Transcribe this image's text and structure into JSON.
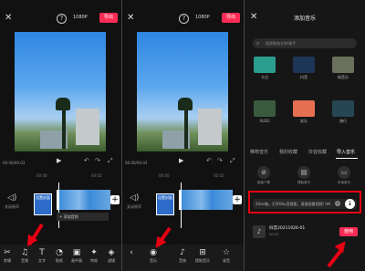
{
  "panel1": {
    "resolution": "1080P",
    "export_label": "导出",
    "timecode": "00:00/00:03",
    "ruler": [
      "00:00",
      "00:02"
    ],
    "mute_label": "关闭原声",
    "cover_label": "设置封面",
    "add_audio_label": "+ 添加音频",
    "tools": [
      {
        "icon": "scissors-icon",
        "glyph": "✂",
        "label": "剪辑"
      },
      {
        "icon": "music-icon",
        "glyph": "♫",
        "label": "音频"
      },
      {
        "icon": "text-icon",
        "glyph": "T",
        "label": "文字"
      },
      {
        "icon": "sticker-icon",
        "glyph": "◔",
        "label": "贴纸"
      },
      {
        "icon": "pip-icon",
        "glyph": "▣",
        "label": "画中画"
      },
      {
        "icon": "effects-icon",
        "glyph": "✦",
        "label": "特效"
      },
      {
        "icon": "filter-icon",
        "glyph": "◈",
        "label": "滤镜"
      }
    ]
  },
  "panel2": {
    "resolution": "1080P",
    "export_label": "导出",
    "timecode": "00:00/00:03",
    "ruler": [
      "00:00",
      "00:02"
    ],
    "mute_label": "关闭原声",
    "cover_label": "设置封面",
    "tools": [
      {
        "icon": "back-icon",
        "glyph": "‹",
        "label": ""
      },
      {
        "icon": "music-icon",
        "glyph": "◉",
        "label": "音乐"
      },
      {
        "icon": "soundfx-icon",
        "glyph": "♪",
        "label": "音效"
      },
      {
        "icon": "extract-icon",
        "glyph": "⊞",
        "label": "提取音乐"
      },
      {
        "icon": "record-icon",
        "glyph": "☆",
        "label": "录音"
      }
    ]
  },
  "panel3": {
    "title": "添加音乐",
    "search_placeholder": "搜索歌曲名称/歌手",
    "categories": [
      {
        "label": "卡点",
        "color": "#2a9d8f"
      },
      {
        "label": "抖音",
        "color": "#1d3557"
      },
      {
        "label": "纯音乐",
        "color": "#6b705c"
      },
      {
        "label": "VLOG",
        "color": "#3a5a40"
      },
      {
        "label": "欢乐",
        "color": "#e76f51"
      },
      {
        "label": "旅行",
        "color": "#264653"
      }
    ],
    "tabs": [
      "推荐音乐",
      "我的收藏",
      "抖音收藏",
      "导入音乐"
    ],
    "options": [
      {
        "icon": "link-icon",
        "glyph": "⊘",
        "label": "链接下载"
      },
      {
        "icon": "video-icon",
        "glyph": "▤",
        "label": "提取音乐"
      },
      {
        "icon": "folder-icon",
        "glyph": "▭",
        "label": "本地音乐"
      }
    ],
    "link_text": "2Sen咖，打开Bilu音搜索，直接观看视频! htt",
    "song_title": "抖音20211026-01",
    "song_duration": "00:13",
    "use_label": "使用"
  },
  "colors": {
    "accent": "#fe2c55",
    "annotation_red": "#e60012"
  }
}
